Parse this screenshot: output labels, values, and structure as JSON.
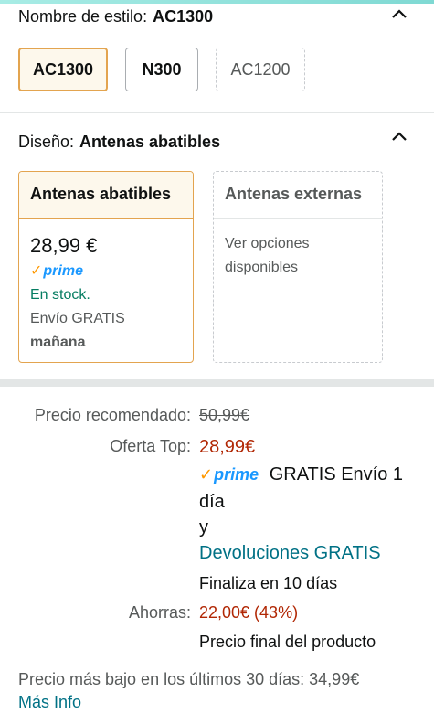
{
  "style": {
    "label": "Nombre de estilo:",
    "value": "AC1300",
    "options": [
      {
        "label": "AC1300",
        "state": "selected"
      },
      {
        "label": "N300",
        "state": "normal"
      },
      {
        "label": "AC1200",
        "state": "unavailable"
      }
    ]
  },
  "design": {
    "label": "Diseño:",
    "value": "Antenas abatibles",
    "cards": [
      {
        "title": "Antenas abatibles",
        "price": "28,99 €",
        "prime": "prime",
        "stock": "En stock.",
        "shipping": "Envío GRATIS",
        "delivery": "mañana"
      },
      {
        "title": "Antenas externas",
        "see_options": "Ver opciones disponibles"
      }
    ]
  },
  "pricing": {
    "recommended_label": "Precio recomendado:",
    "recommended_value": "50,99€",
    "deal_label": "Oferta Top:",
    "deal_value": "28,99€",
    "prime": "prime",
    "prime_text": "GRATIS Envío 1 día",
    "and": "y",
    "returns_link": "Devoluciones GRATIS",
    "ends": "Finaliza en 10 días",
    "savings_label": "Ahorras:",
    "savings_value": "22,00€ (43%)",
    "final_price": "Precio final del producto",
    "lowest_price": "Precio más bajo en los últimos 30 días: 34,99€",
    "more_info": "Más Info"
  },
  "colors": {
    "accent": "#e3a44f",
    "deal": "#b12704",
    "link": "#007185",
    "instock": "#067d62",
    "prime": "#1a98ff"
  }
}
